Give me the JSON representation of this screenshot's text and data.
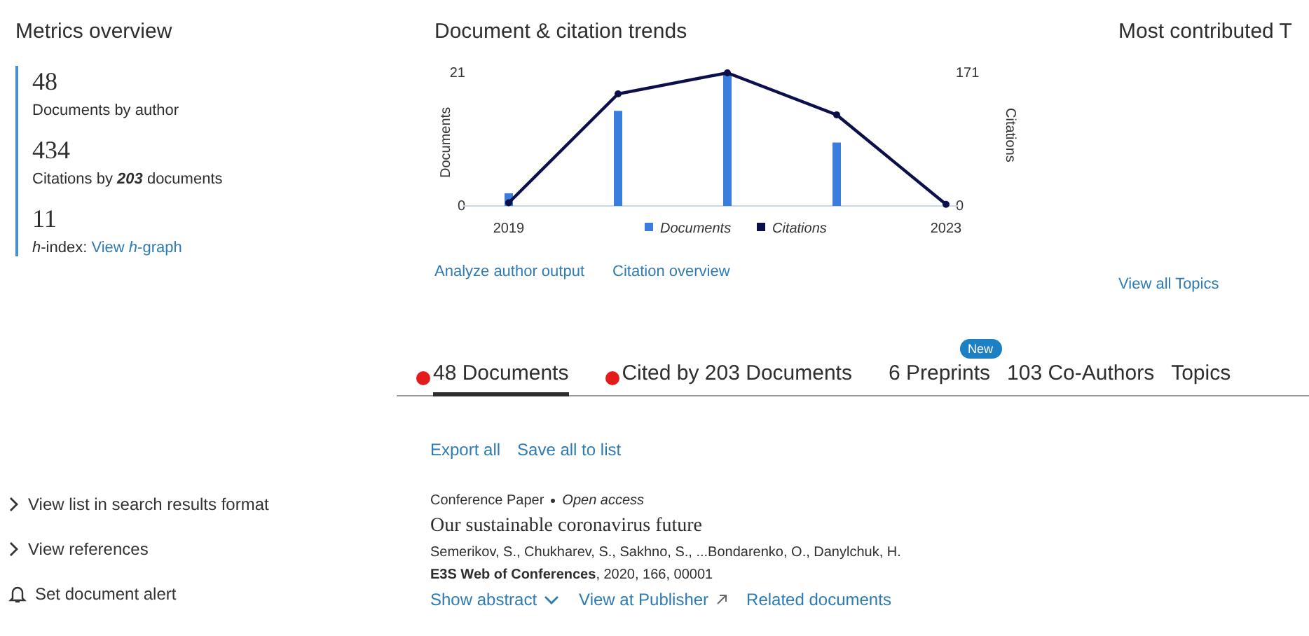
{
  "metrics": {
    "title": "Metrics overview",
    "items": [
      {
        "value": "48",
        "label": "Documents by author"
      },
      {
        "value": "434",
        "label": "Citations by **203** documents"
      },
      {
        "value": "11",
        "label": "*h*-index:",
        "link": "View *h*-graph"
      }
    ]
  },
  "trends": {
    "title": "Document & citation trends",
    "chart_data": {
      "type": "bar",
      "ylabel": "Documents",
      "y2label": "Citations",
      "categories": [
        "2019",
        null,
        null,
        null,
        "2023"
      ],
      "yticks": [
        0,
        21
      ],
      "y2ticks": [
        0,
        171
      ],
      "ylim": [
        0,
        21
      ],
      "y2lim": [
        0,
        171
      ],
      "legend": "bottom",
      "series": [
        {
          "name": "Documents",
          "type": "bar",
          "color": "#3b7ddd",
          "values": [
            2,
            15,
            21,
            10,
            0
          ]
        },
        {
          "name": "Citations",
          "type": "line",
          "marker": "circle",
          "axis": "y2",
          "color": "#0c0f4a",
          "values": [
            4,
            144,
            171,
            117,
            2
          ]
        }
      ]
    },
    "links": [
      "Analyze author output",
      "Citation overview"
    ]
  },
  "topics": {
    "title": "Most contributed T",
    "link": "View all Topics"
  },
  "tabs": [
    {
      "label": "48 Documents",
      "selected": true,
      "marked": true
    },
    {
      "label": "Cited by 203 Documents",
      "selected": false,
      "marked": true
    },
    {
      "label": "6 Preprints",
      "selected": false,
      "marked": false,
      "badge": "New"
    },
    {
      "label": "103 Co-Authors",
      "selected": false,
      "marked": false
    },
    {
      "label": "Topics",
      "selected": false,
      "marked": false
    }
  ],
  "side_actions": [
    {
      "kind": "chevron",
      "label": "View list in search results format"
    },
    {
      "kind": "chevron",
      "label": "View references"
    },
    {
      "kind": "bell",
      "label": "Set document alert"
    }
  ],
  "list_actions": [
    "Export all",
    "Save all to list"
  ],
  "document": {
    "type": "Conference Paper",
    "access": "Open access",
    "title": "Our sustainable coronavirus future",
    "authors": "Semerikov, S., Chukharev, S., Sakhno, S., ...Bondarenko, O., Danylchuk, H.",
    "source": "**E3S Web of Conferences**, 2020, 166, 00001",
    "links": [
      {
        "kind": "expand",
        "label": "Show abstract"
      },
      {
        "kind": "external",
        "label": "View at Publisher"
      },
      {
        "kind": "plain",
        "label": "Related documents"
      }
    ]
  }
}
